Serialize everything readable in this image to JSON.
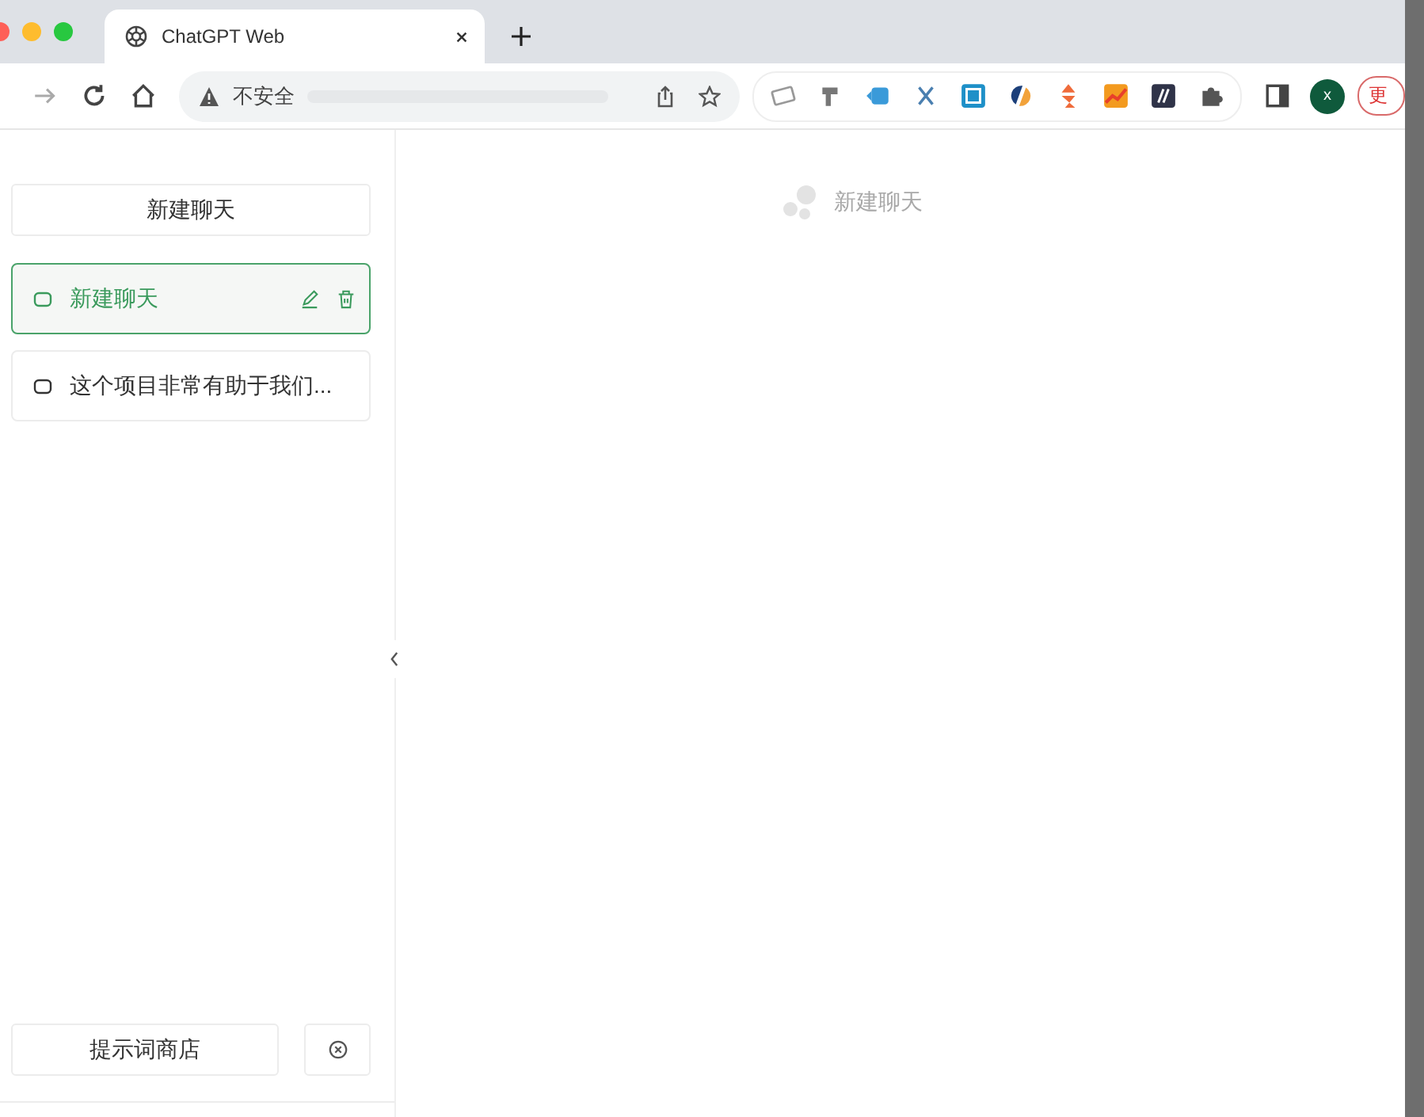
{
  "browser": {
    "tab": {
      "title": "ChatGPT Web"
    },
    "address": {
      "security": "不安全"
    },
    "profile": {
      "initial": "x"
    },
    "update_button": {
      "label": "更"
    }
  },
  "sidebar": {
    "new_chat_button": "新建聊天",
    "chats": [
      {
        "title": "新建聊天",
        "selected": true
      },
      {
        "title": "这个项目非常有助于我们...",
        "selected": false
      }
    ],
    "prompt_store_button": "提示词商店"
  },
  "main": {
    "empty_state": "新建聊天"
  }
}
